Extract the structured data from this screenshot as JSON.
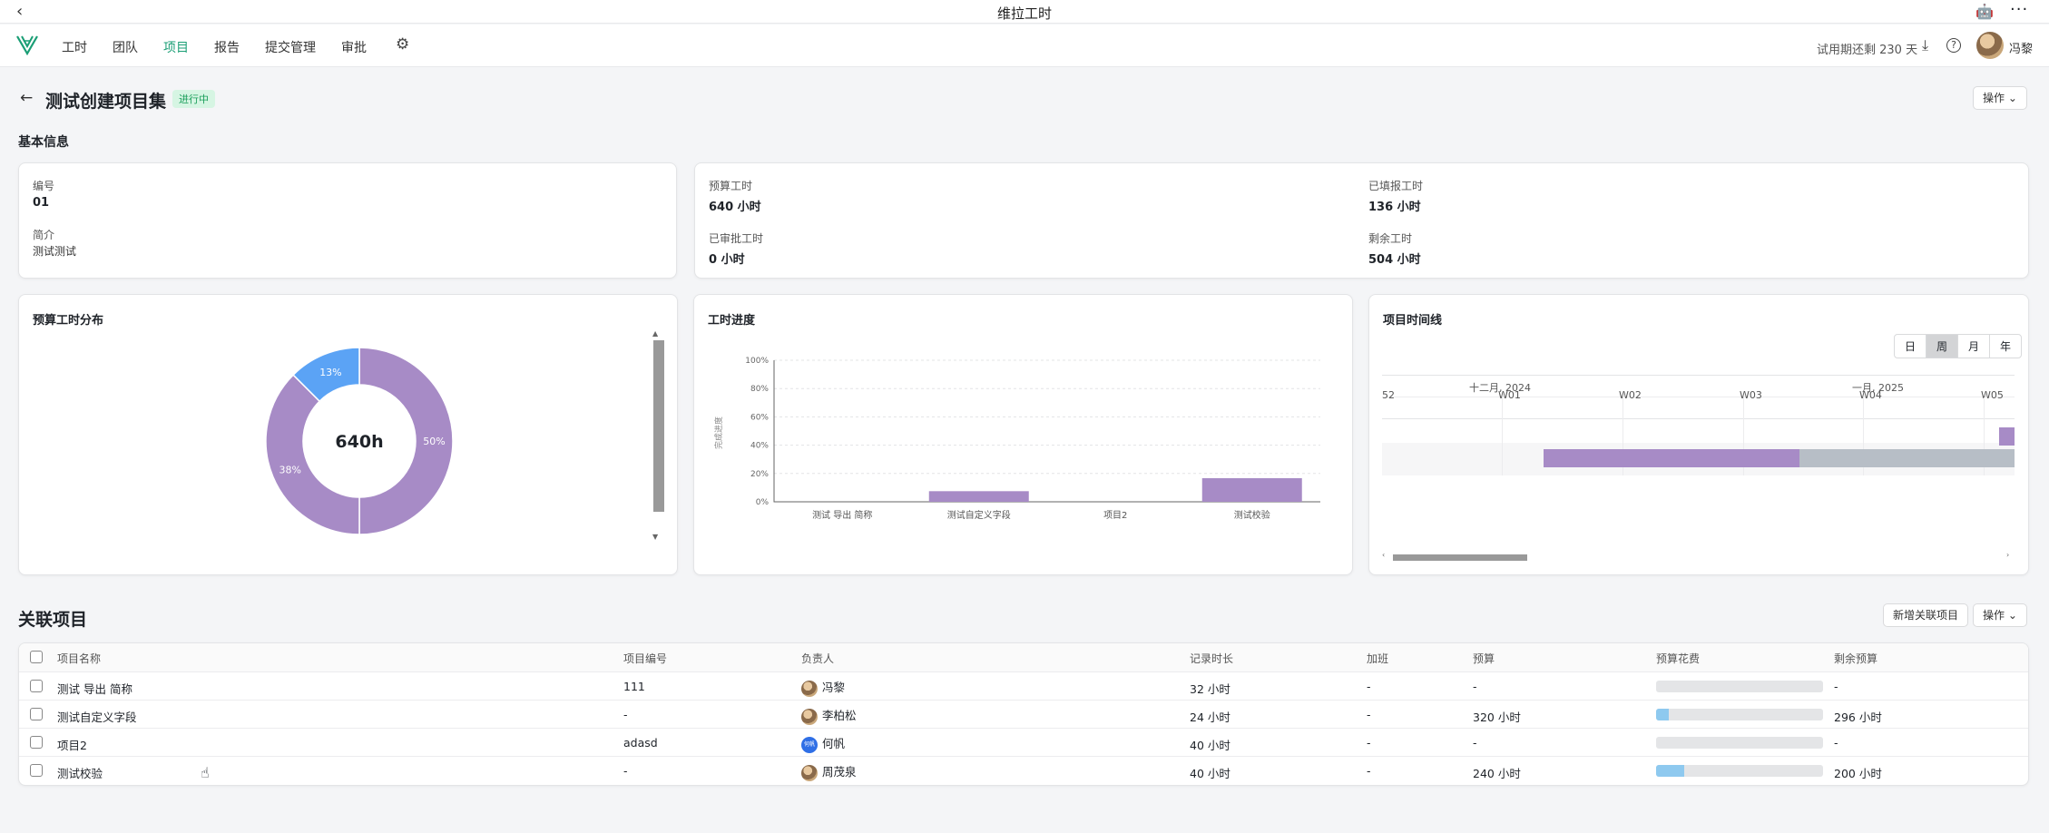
{
  "window": {
    "title": "维拉工时"
  },
  "nav": {
    "items": [
      {
        "label": "工时",
        "active": false
      },
      {
        "label": "团队",
        "active": false
      },
      {
        "label": "项目",
        "active": true
      },
      {
        "label": "报告",
        "active": false
      },
      {
        "label": "提交管理",
        "active": false
      },
      {
        "label": "审批",
        "active": false
      }
    ],
    "trial_text": "试用期还剩 230 天",
    "username": "冯黎"
  },
  "header": {
    "title": "测试创建项目集",
    "status": "进行中",
    "ops_label": "操作"
  },
  "basic_info": {
    "section_label": "基本信息",
    "code_label": "编号",
    "code_value": "01",
    "intro_label": "简介",
    "intro_value": "测试测试",
    "budget_label": "预算工时",
    "budget_value": "640 小时",
    "reported_label": "已填报工时",
    "reported_value": "136 小时",
    "approved_label": "已审批工时",
    "approved_value": "0 小时",
    "remaining_label": "剩余工时",
    "remaining_value": "504 小时"
  },
  "donut": {
    "title": "预算工时分布",
    "center": "640h",
    "slices": [
      {
        "label": "50%",
        "value": 50,
        "color": "#a78bc6"
      },
      {
        "label": "38%",
        "value": 37.5,
        "color": "#a78bc6"
      },
      {
        "label": "13%",
        "value": 12.5,
        "color": "#5ba3f5"
      }
    ]
  },
  "progress_chart": {
    "title": "工时进度",
    "ylabel": "完成进度",
    "yticks": [
      "100%",
      "80%",
      "60%",
      "40%",
      "20%",
      "0%"
    ]
  },
  "chart_data": {
    "type": "bar",
    "categories": [
      "测试 导出 简称",
      "测试自定义字段",
      "项目2",
      "测试校验"
    ],
    "values": [
      0,
      7.5,
      0,
      16.7
    ],
    "ylabel": "完成进度",
    "ylim": [
      0,
      100
    ],
    "color": "#a78bc6"
  },
  "timeline": {
    "title": "项目时间线",
    "scales": [
      {
        "label": "日",
        "active": false
      },
      {
        "label": "周",
        "active": true
      },
      {
        "label": "月",
        "active": false
      },
      {
        "label": "年",
        "active": false
      }
    ],
    "months": [
      "十二月, 2024",
      "一月, 2025"
    ],
    "weeks": [
      "52",
      "W01",
      "W02",
      "W03",
      "W04",
      "W05"
    ]
  },
  "related": {
    "title": "关联项目",
    "add_label": "新增关联项目",
    "ops_label": "操作",
    "columns": [
      "项目名称",
      "项目编号",
      "负责人",
      "记录时长",
      "加班",
      "预算",
      "预算花费",
      "剩余预算"
    ],
    "rows": [
      {
        "name": "测试 导出 简称",
        "code": "111",
        "owner": "冯黎",
        "owner_avatar": "photo",
        "hours": "32 小时",
        "overtime": "-",
        "budget": "-",
        "spent_fraction": 0,
        "remaining": "-"
      },
      {
        "name": "测试自定义字段",
        "code": "-",
        "owner": "李柏松",
        "owner_avatar": "photo",
        "hours": "24 小时",
        "overtime": "-",
        "budget": "320 小时",
        "spent_fraction": 0.075,
        "remaining": "296 小时"
      },
      {
        "name": "项目2",
        "code": "adasd",
        "owner": "何帆",
        "owner_avatar": "何帆",
        "hours": "40 小时",
        "overtime": "-",
        "budget": "-",
        "spent_fraction": 0,
        "remaining": "-"
      },
      {
        "name": "测试校验",
        "code": "-",
        "owner": "周茂泉",
        "owner_avatar": "photo",
        "hours": "40 小时",
        "overtime": "-",
        "budget": "240 小时",
        "spent_fraction": 0.167,
        "remaining": "200 小时"
      }
    ]
  }
}
